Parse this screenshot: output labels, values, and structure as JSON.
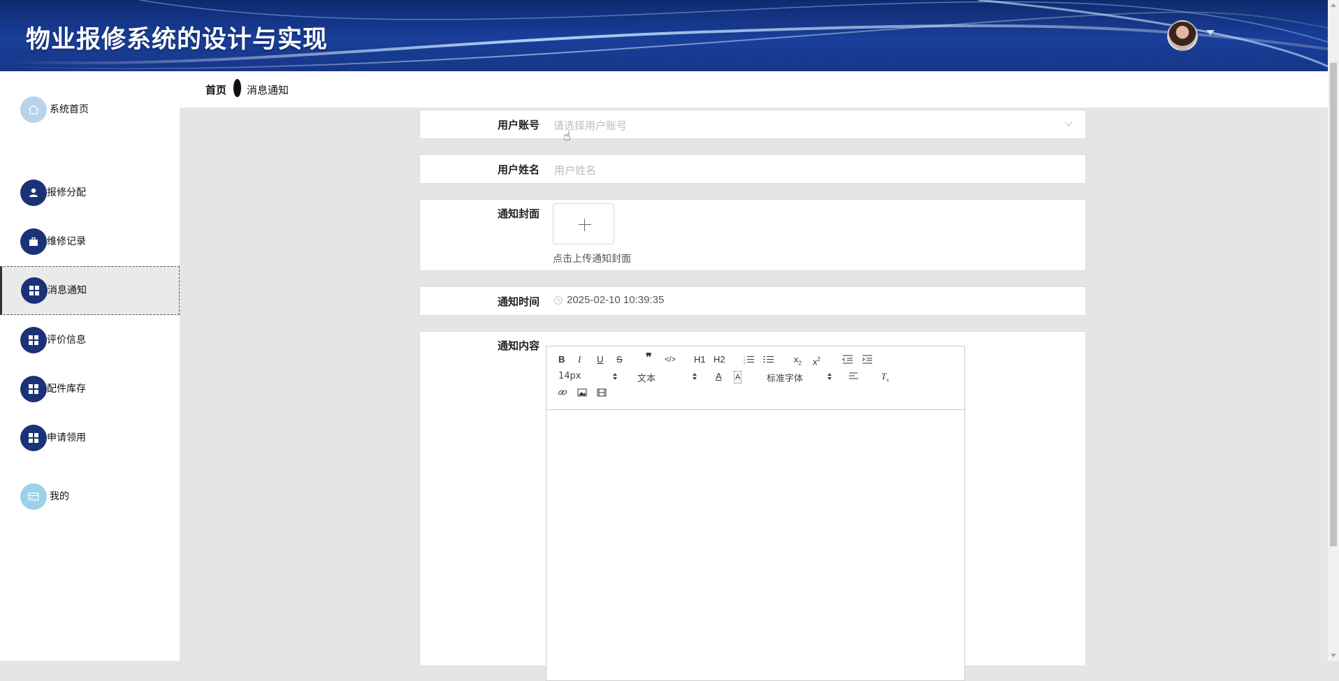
{
  "header": {
    "title": "物业报修系统的设计与实现",
    "avatar_name": "user-avatar"
  },
  "breadcrumb": {
    "home": "首页",
    "current": "消息通知"
  },
  "sidebar": {
    "items": [
      {
        "label": "系统首页",
        "icon": "home-icon"
      },
      {
        "label": "报修分配",
        "icon": "user-icon"
      },
      {
        "label": "维修记录",
        "icon": "briefcase-icon"
      },
      {
        "label": "消息通知",
        "icon": "grid-icon",
        "active": true
      },
      {
        "label": "评价信息",
        "icon": "grid-icon"
      },
      {
        "label": "配件库存",
        "icon": "grid-icon"
      },
      {
        "label": "申请领用",
        "icon": "grid-icon"
      },
      {
        "label": "我的",
        "icon": "card-icon"
      }
    ]
  },
  "form": {
    "account": {
      "label": "用户账号",
      "placeholder": "请选择用户账号"
    },
    "name": {
      "label": "用户姓名",
      "placeholder": "用户姓名"
    },
    "cover": {
      "label": "通知封面",
      "tip": "点击上传通知封面"
    },
    "time": {
      "label": "通知时间",
      "value": "2025-02-10 10:39:35"
    },
    "content": {
      "label": "通知内容"
    }
  },
  "editor": {
    "font_size": "14px",
    "header_select": "文本",
    "font_family": "标准字体",
    "h1": "H1",
    "h2": "H2"
  },
  "colors": {
    "header_bg": "#1a3f9a",
    "nav_icon": "#1b3276",
    "page_bg": "#e5e5e5"
  }
}
